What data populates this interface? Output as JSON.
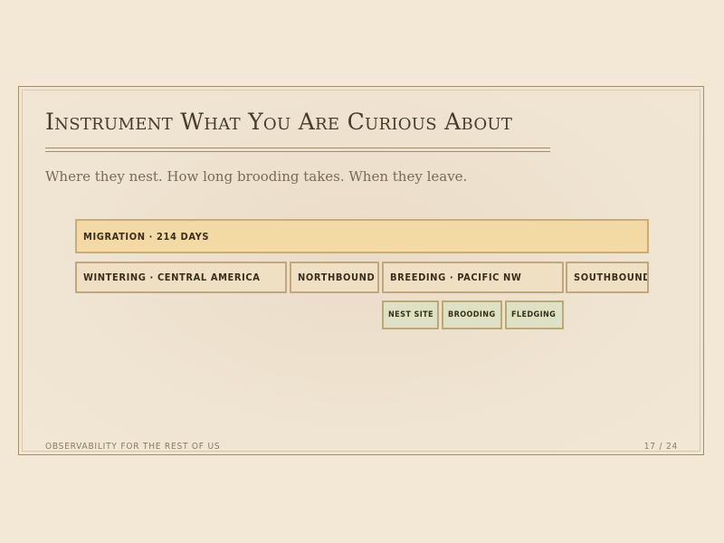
{
  "slide": {
    "title": "Instrument What You Are Curious About",
    "subtitle": "Where they nest. How long brooding takes. When they leave."
  },
  "timeline": {
    "migration": "MIGRATION · 214 DAYS",
    "phases": [
      "WINTERING · CENTRAL AMERICA",
      "NORTHBOUND",
      "BREEDING · PACIFIC NW",
      "SOUTHBOUND"
    ],
    "breeding_subphases": [
      "NEST SITE",
      "BROODING",
      "FLEDGING"
    ]
  },
  "footer": {
    "deck_title": "OBSERVABILITY FOR THE REST OF US",
    "page": "17 / 24"
  },
  "colors": {
    "background": "#f3e7d6",
    "migration_bar": "#f3d9a4",
    "phase_bar": "#efe0c4",
    "subphase_bar": "#dde2c4",
    "border": "#bfa87d",
    "title_text": "#4a3a28"
  }
}
